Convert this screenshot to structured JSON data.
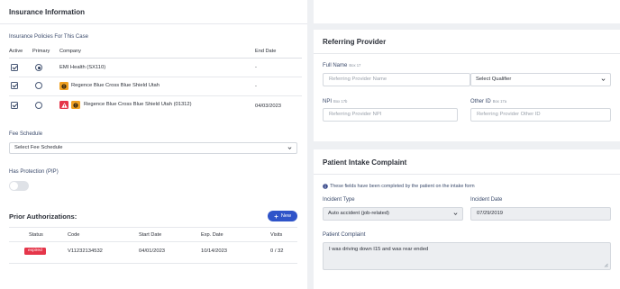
{
  "insurance": {
    "title": "Insurance Information",
    "policies_label": "Insurance Policies For This Case",
    "columns": {
      "active": "Active",
      "primary": "Primary",
      "company": "Company",
      "end_date": "End Date"
    },
    "rows": [
      {
        "company": "EMI Health (SX110)",
        "end_date": "-",
        "primary": true
      },
      {
        "company": "Regence Blue Cross Blue Shield Utah",
        "end_date": "-",
        "primary": false
      },
      {
        "company": "Regence Blue Cross Blue Shield Utah (01312)",
        "end_date": "04/03/2023",
        "primary": false
      }
    ],
    "fee_schedule": {
      "label": "Fee Schedule",
      "value": "Select Fee Schedule"
    },
    "pip": {
      "label": "Has Protection (PIP)"
    }
  },
  "authorizations": {
    "title": "Prior Authorizations:",
    "new_button": "New",
    "columns": {
      "status": "Status",
      "code": "Code",
      "start": "Start Date",
      "exp": "Exp. Date",
      "visits": "Visits"
    },
    "rows": [
      {
        "status": "expired",
        "code": "V11232134532",
        "start": "04/01/2023",
        "exp": "10/14/2023",
        "visits": "0 / 32"
      }
    ]
  },
  "referring": {
    "title": "Referring Provider",
    "full_name": {
      "label": "Full Name",
      "hint": "Box 17",
      "placeholder": "Referring Provider Name"
    },
    "qualifier": {
      "value": "Select Qualifier"
    },
    "npi": {
      "label": "NPI",
      "hint": "Box 17b",
      "placeholder": "Referring Provider NPI"
    },
    "other_id": {
      "label": "Other ID",
      "hint": "Box 17a",
      "placeholder": "Referring Provider Other ID"
    }
  },
  "intake": {
    "title": "Patient Intake Complaint",
    "notice": "These fields have been completed by the patient on the intake form",
    "incident_type": {
      "label": "Incident Type",
      "value": "Auto accident (job-related)"
    },
    "incident_date": {
      "label": "Incident Date",
      "value": "07/29/2019"
    },
    "complaint": {
      "label": "Patient Complaint",
      "value": "I was driving down I15 and was rear ended"
    }
  },
  "colors": {
    "accent": "#2f54c9",
    "expired": "#e5364a",
    "warning": "#f0a020",
    "alert": "#e5364a"
  },
  "icons": [
    "chevron-down-icon",
    "warning-icon",
    "alert-triangle-icon",
    "plus-icon",
    "info-icon",
    "resize-handle-icon"
  ]
}
